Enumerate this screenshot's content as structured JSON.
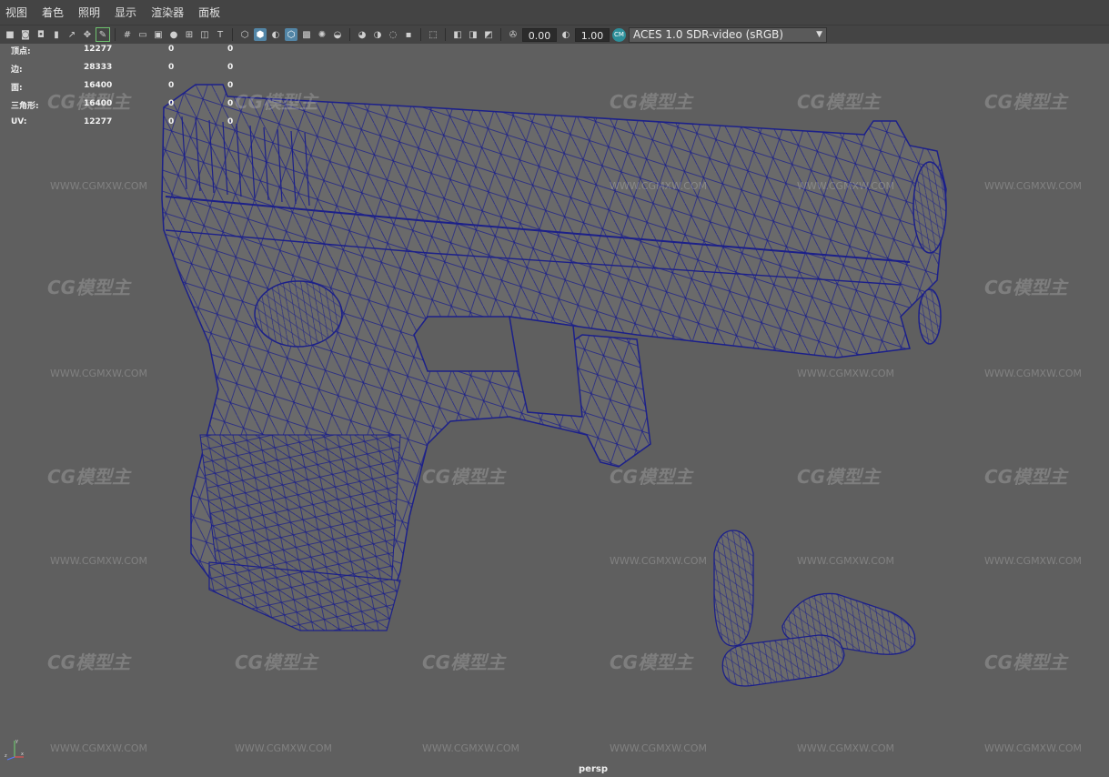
{
  "menubar": {
    "items": [
      "视图",
      "着色",
      "照明",
      "显示",
      "渲染器",
      "面板"
    ]
  },
  "toolbar": {
    "field_1": "0.00",
    "field_2": "1.00",
    "color_management_badge": "CM",
    "color_management_value": "ACES 1.0 SDR-video (sRGB)"
  },
  "hud": {
    "rows": [
      {
        "label": "顶点:",
        "v1": "12277",
        "v2": "0",
        "v3": "0"
      },
      {
        "label": "边:",
        "v1": "28333",
        "v2": "0",
        "v3": "0"
      },
      {
        "label": "面:",
        "v1": "16400",
        "v2": "0",
        "v3": "0"
      },
      {
        "label": "三角形:",
        "v1": "16400",
        "v2": "0",
        "v3": "0"
      },
      {
        "label": "UV:",
        "v1": "12277",
        "v2": "0",
        "v3": "0"
      }
    ]
  },
  "viewport": {
    "camera_label": "persp",
    "wire_color": "#1a1d8c",
    "mesh_color": "#6a6a6a",
    "watermark_logo": "CG模型主",
    "watermark_url": "WWW.CGMXW.COM"
  },
  "axis": {
    "x": "x",
    "y": "y",
    "z": "z"
  }
}
